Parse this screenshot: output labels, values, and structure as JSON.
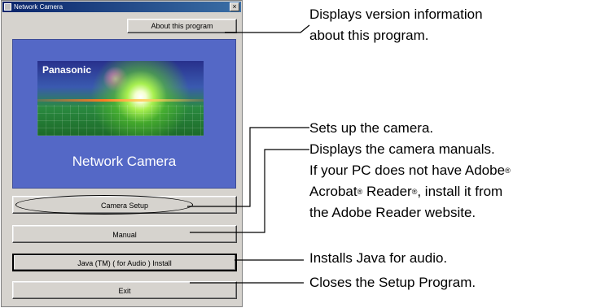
{
  "window": {
    "title": "Network Camera",
    "close_glyph": "×",
    "buttons": {
      "about": "About this program",
      "camera_setup": "Camera Setup",
      "manual": "Manual",
      "java": "Java (TM)   ( for Audio ) Install",
      "exit": "Exit"
    },
    "banner": {
      "brand": "Panasonic",
      "caption": "Network Camera"
    }
  },
  "annotations": {
    "about_line1": "Displays version information",
    "about_line2": "about this program.",
    "setup": "Sets up the camera.",
    "manual": "Displays the camera manuals.",
    "adobe_line1_pre": "If your PC does not have Adobe",
    "adobe_line2_a": "Acrobat",
    "adobe_line2_b": " Reader",
    "adobe_line2_c": ", install it from",
    "adobe_line3": "the Adobe Reader website.",
    "registered_mark": "®",
    "java": "Installs Java for audio.",
    "exit": "Closes the Setup Program."
  }
}
